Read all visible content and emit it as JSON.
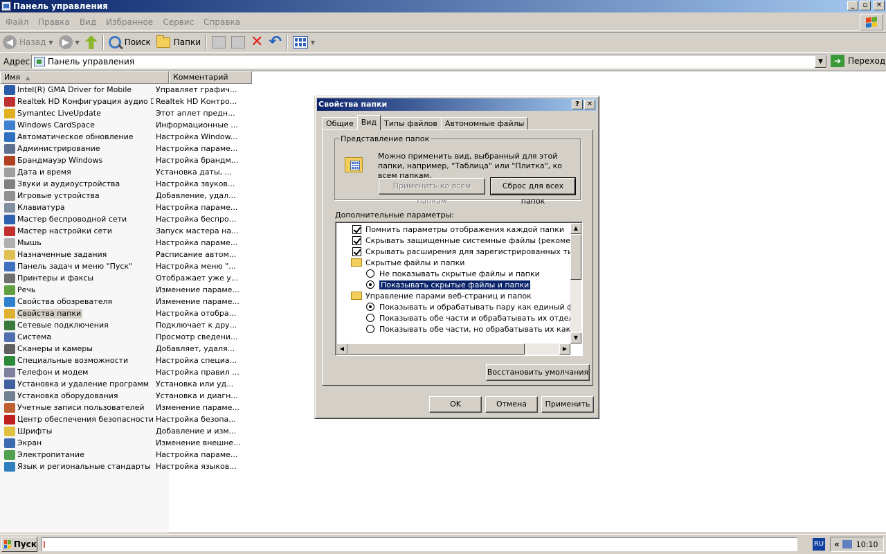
{
  "window": {
    "title": "Панель управления",
    "buttons": {
      "minimize": "_",
      "maximize": "▫",
      "close": "✕"
    }
  },
  "menu": [
    "Файл",
    "Правка",
    "Вид",
    "Избранное",
    "Сервис",
    "Справка"
  ],
  "toolbar": {
    "back_label": "Назад",
    "search_label": "Поиск",
    "folders_label": "Папки"
  },
  "address": {
    "label": "Адрес:",
    "value": "Панель управления",
    "go_label": "Переход"
  },
  "list": {
    "columns": {
      "name": "Имя",
      "comment": "Комментарий"
    },
    "items": [
      {
        "name": "Intel(R) GMA Driver for Mobile",
        "comment": "Управляет графич...",
        "icon_color": "#2a5caa"
      },
      {
        "name": "Realtek HD Конфигурация аудио ☐",
        "comment": "Realtek HD Контро...",
        "icon_color": "#c03030"
      },
      {
        "name": "Symantec LiveUpdate",
        "comment": "Этот аплет предн...",
        "icon_color": "#e0b020"
      },
      {
        "name": "Windows CardSpace",
        "comment": "Информационные ...",
        "icon_color": "#4080d0"
      },
      {
        "name": "Автоматическое обновление",
        "comment": "Настройка Window...",
        "icon_color": "#3070c0"
      },
      {
        "name": "Администрирование",
        "comment": "Настройка параме...",
        "icon_color": "#607090"
      },
      {
        "name": "Брандмауэр Windows",
        "comment": "Настройка брандм...",
        "icon_color": "#b04020"
      },
      {
        "name": "Дата и время",
        "comment": "Установка даты, ...",
        "icon_color": "#a0a0a0"
      },
      {
        "name": "Звуки и аудиоустройства",
        "comment": "Настройка звуков...",
        "icon_color": "#808080"
      },
      {
        "name": "Игровые устройства",
        "comment": "Добавление, удал...",
        "icon_color": "#909090"
      },
      {
        "name": "Клавиатура",
        "comment": "Настройка параме...",
        "icon_color": "#8090a0"
      },
      {
        "name": "Мастер беспроводной сети",
        "comment": "Настройка беспро...",
        "icon_color": "#3060b0"
      },
      {
        "name": "Мастер настройки сети",
        "comment": "Запуск мастера на...",
        "icon_color": "#c03030"
      },
      {
        "name": "Мышь",
        "comment": "Настройка параме...",
        "icon_color": "#b0b0b0"
      },
      {
        "name": "Назначенные задания",
        "comment": "Расписание автом...",
        "icon_color": "#e0c050"
      },
      {
        "name": "Панель задач и меню \"Пуск\"",
        "comment": "Настройка меню \"...",
        "icon_color": "#4070c0"
      },
      {
        "name": "Принтеры и факсы",
        "comment": "Отображает уже у...",
        "icon_color": "#707070"
      },
      {
        "name": "Речь",
        "comment": "Изменение параме...",
        "icon_color": "#60a040"
      },
      {
        "name": "Свойства обозревателя",
        "comment": "Изменение параме...",
        "icon_color": "#3080d0"
      },
      {
        "name": "Свойства папки",
        "comment": "Настройка отобра...",
        "icon_color": "#e0b030",
        "selected": true
      },
      {
        "name": "Сетевые подключения",
        "comment": "Подключает к дру...",
        "icon_color": "#3a7a3a"
      },
      {
        "name": "Система",
        "comment": "Просмотр сведени...",
        "icon_color": "#5070b0"
      },
      {
        "name": "Сканеры и камеры",
        "comment": "Добавляет, удаля...",
        "icon_color": "#606060"
      },
      {
        "name": "Специальные возможности",
        "comment": "Настройка специа...",
        "icon_color": "#2a8a3a"
      },
      {
        "name": "Телефон и модем",
        "comment": "Настройка правил ...",
        "icon_color": "#8080a0"
      },
      {
        "name": "Установка и удаление программ",
        "comment": "Установка или уд...",
        "icon_color": "#4060a0"
      },
      {
        "name": "Установка оборудования",
        "comment": "Установка и диагн...",
        "icon_color": "#708090"
      },
      {
        "name": "Учетные записи пользователей",
        "comment": "Изменение параме...",
        "icon_color": "#c06030"
      },
      {
        "name": "Центр обеспечения безопасности",
        "comment": "Настройка безопа...",
        "icon_color": "#c02020"
      },
      {
        "name": "Шрифты",
        "comment": "Добавление и изм...",
        "icon_color": "#e0c040"
      },
      {
        "name": "Экран",
        "comment": "Изменение внешне...",
        "icon_color": "#3a6ab0"
      },
      {
        "name": "Электропитание",
        "comment": "Настройка параме...",
        "icon_color": "#50a050"
      },
      {
        "name": "Язык и региональные стандарты",
        "comment": "Настройка языков...",
        "icon_color": "#3080c0"
      }
    ]
  },
  "dialog": {
    "title": "Свойства папки",
    "help_button": "?",
    "close_button": "✕",
    "tabs": [
      "Общие",
      "Вид",
      "Типы файлов",
      "Автономные файлы"
    ],
    "active_tab": "Вид",
    "folder_views": {
      "title": "Представление папок",
      "description": "Можно применить вид, выбранный для этой папки, например, \"Таблица\" или \"Плитка\", ко всем папкам.",
      "apply_all_label": "Применить ко всем папкам",
      "reset_all_label": "Сброс для всех папок"
    },
    "advanced_label": "Дополнительные параметры:",
    "options": [
      {
        "type": "checkbox",
        "checked": true,
        "label": "Помнить параметры отображения каждой папки",
        "indent": 1
      },
      {
        "type": "checkbox",
        "checked": true,
        "label": "Скрывать защищенные системные файлы (рекомендуетс",
        "indent": 1
      },
      {
        "type": "checkbox",
        "checked": true,
        "label": "Скрывать расширения для зарегистрированных типов фа",
        "indent": 1
      },
      {
        "type": "folder",
        "label": "Скрытые файлы и папки",
        "indent": 1
      },
      {
        "type": "radio",
        "checked": false,
        "label": "Не показывать скрытые файлы и папки",
        "indent": 2
      },
      {
        "type": "radio",
        "checked": true,
        "label": "Показывать скрытые файлы и папки",
        "indent": 2,
        "highlighted": true
      },
      {
        "type": "folder",
        "label": "Управление парами веб-страниц и папок",
        "indent": 1
      },
      {
        "type": "radio",
        "checked": true,
        "label": "Показывать и обрабатывать пару как единый файл",
        "indent": 2
      },
      {
        "type": "radio",
        "checked": false,
        "label": "Показывать обе части и обрабатывать их отдельно",
        "indent": 2
      },
      {
        "type": "radio",
        "checked": false,
        "label": "Показывать обе части, но обрабатывать их как единь",
        "indent": 2
      }
    ],
    "restore_defaults_label": "Восстановить умолчания",
    "ok_label": "OK",
    "cancel_label": "Отмена",
    "apply_label": "Применить"
  },
  "taskbar": {
    "start_label": "Пуск",
    "language": "RU",
    "tray_chevron": "«",
    "clock": "10:10"
  }
}
